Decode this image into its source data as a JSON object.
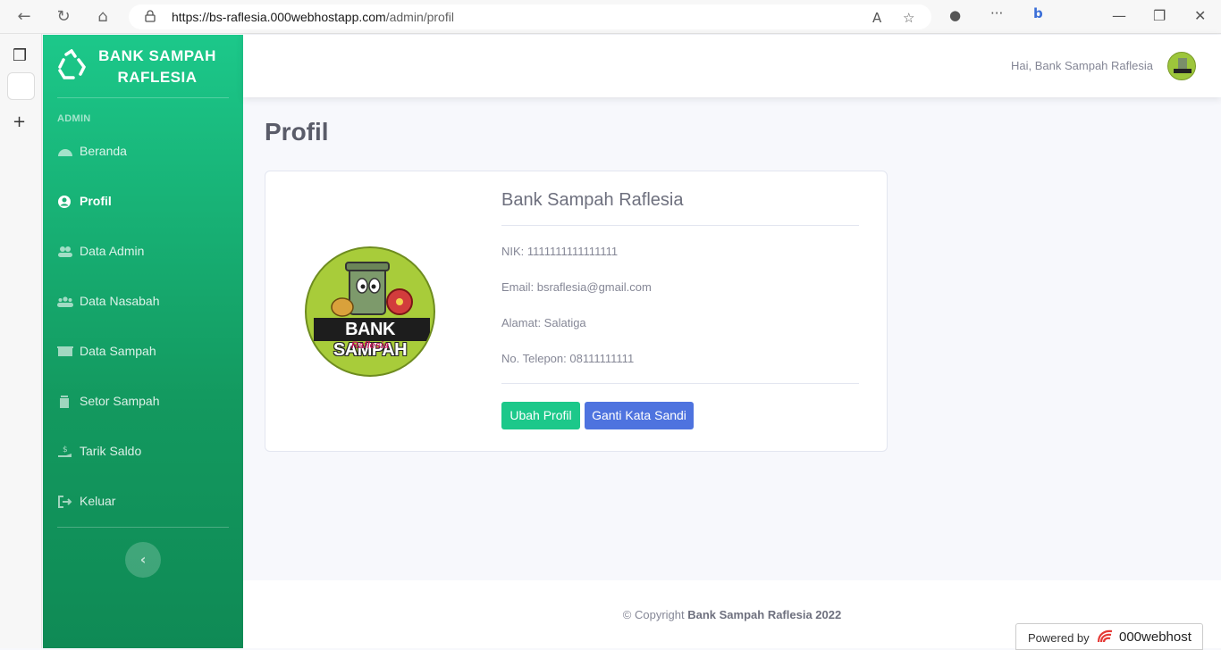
{
  "browser": {
    "url_host": "https://bs-raflesia.000webhostapp.com",
    "url_path": "/admin/profil"
  },
  "sidebar": {
    "brand": "BANK SAMPAH RAFLESIA",
    "section": "ADMIN",
    "items": [
      {
        "label": "Beranda",
        "icon": "tachometer-icon"
      },
      {
        "label": "Profil",
        "icon": "user-circle-icon",
        "active": true
      },
      {
        "label": "Data Admin",
        "icon": "users-icon"
      },
      {
        "label": "Data Nasabah",
        "icon": "user-group-icon"
      },
      {
        "label": "Data Sampah",
        "icon": "dumpster-icon"
      },
      {
        "label": "Setor Sampah",
        "icon": "trash-icon"
      },
      {
        "label": "Tarik Saldo",
        "icon": "hand-money-icon"
      },
      {
        "label": "Keluar",
        "icon": "sign-out-icon"
      }
    ]
  },
  "topbar": {
    "greeting": "Hai, Bank Sampah Raflesia"
  },
  "main": {
    "title": "Profil",
    "profile": {
      "name": "Bank Sampah Raflesia",
      "logo_text": "BANK SAMPAH",
      "logo_sub": "Raflesia",
      "nik": "NIK: 1111111111111111",
      "email": "Email: bsraflesia@gmail.com",
      "alamat": "Alamat: Salatiga",
      "telepon": "No. Telepon: 08111111111"
    },
    "buttons": {
      "edit": "Ubah Profil",
      "password": "Ganti Kata Sandi"
    }
  },
  "footer": {
    "prefix": "© Copyright",
    "owner": "Bank Sampah Raflesia 2022",
    "powered_by": "Powered by",
    "host": "000webhost"
  },
  "colors": {
    "primary_green": "#1cc88a",
    "primary_blue": "#4e73df"
  }
}
